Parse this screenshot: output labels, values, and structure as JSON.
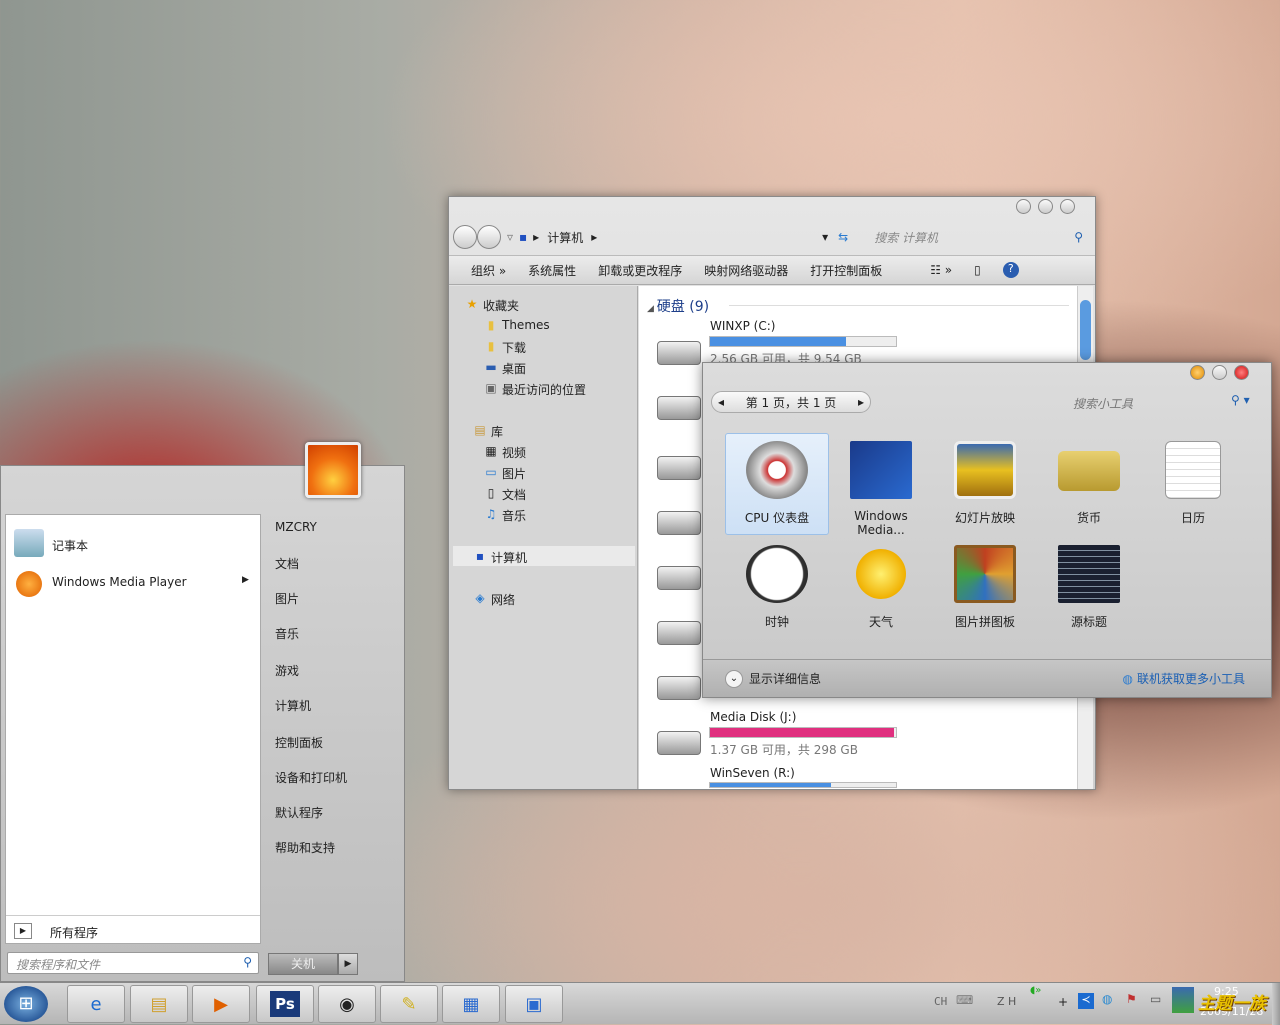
{
  "explorer": {
    "breadcrumb": [
      "计算机"
    ],
    "search_placeholder": "搜索 计算机",
    "toolbar": [
      "组织 »",
      "系统属性",
      "卸载或更改程序",
      "映射网络驱动器",
      "打开控制面板"
    ],
    "nav": {
      "favorites": "收藏夹",
      "fav_items": [
        "Themes",
        "下载",
        "桌面",
        "最近访问的位置"
      ],
      "libraries": "库",
      "lib_items": [
        "视频",
        "图片",
        "文档",
        "音乐"
      ],
      "computer": "计算机",
      "network": "网络"
    },
    "group_title": "硬盘 (9)",
    "drives": [
      {
        "name": "WINXP (C:)",
        "info": "2.56 GB 可用，共 9.54 GB",
        "used_percent": 73,
        "color": "#4a90e2"
      },
      {
        "name": "Media Disk (J:)",
        "info": "1.37 GB 可用，共 298 GB",
        "used_percent": 99,
        "color": "#e0307f"
      },
      {
        "name": "WinSeven (R:)",
        "info": "",
        "used_percent": 65,
        "color": "#4a90e2"
      }
    ]
  },
  "gadgets": {
    "pager": "第 1 页，共 1 页",
    "search_placeholder": "搜索小工具",
    "items": [
      "CPU 仪表盘",
      "Windows Media...",
      "幻灯片放映",
      "货币",
      "日历",
      "时钟",
      "天气",
      "图片拼图板",
      "源标题"
    ],
    "selected": "CPU 仪表盘",
    "details": "显示详细信息",
    "more_link": "联机获取更多小工具"
  },
  "start_menu": {
    "programs": [
      "记事本",
      "Windows Media Player"
    ],
    "all_programs": "所有程序",
    "search_placeholder": "搜索程序和文件",
    "right_items": [
      "MZCRY",
      "文档",
      "图片",
      "音乐",
      "游戏",
      "计算机",
      "控制面板",
      "设备和打印机",
      "默认程序",
      "帮助和支持"
    ],
    "shutdown": "关机"
  },
  "taskbar": {
    "apps": [
      "internet-explorer",
      "file-explorer",
      "media-player",
      "photoshop",
      "media-center",
      "notes",
      "control-panel",
      "remote-desktop"
    ],
    "lang": "CH",
    "ime": "Z H",
    "time": "9:25",
    "date": "2009/11/28",
    "watermark": "主题一族"
  }
}
